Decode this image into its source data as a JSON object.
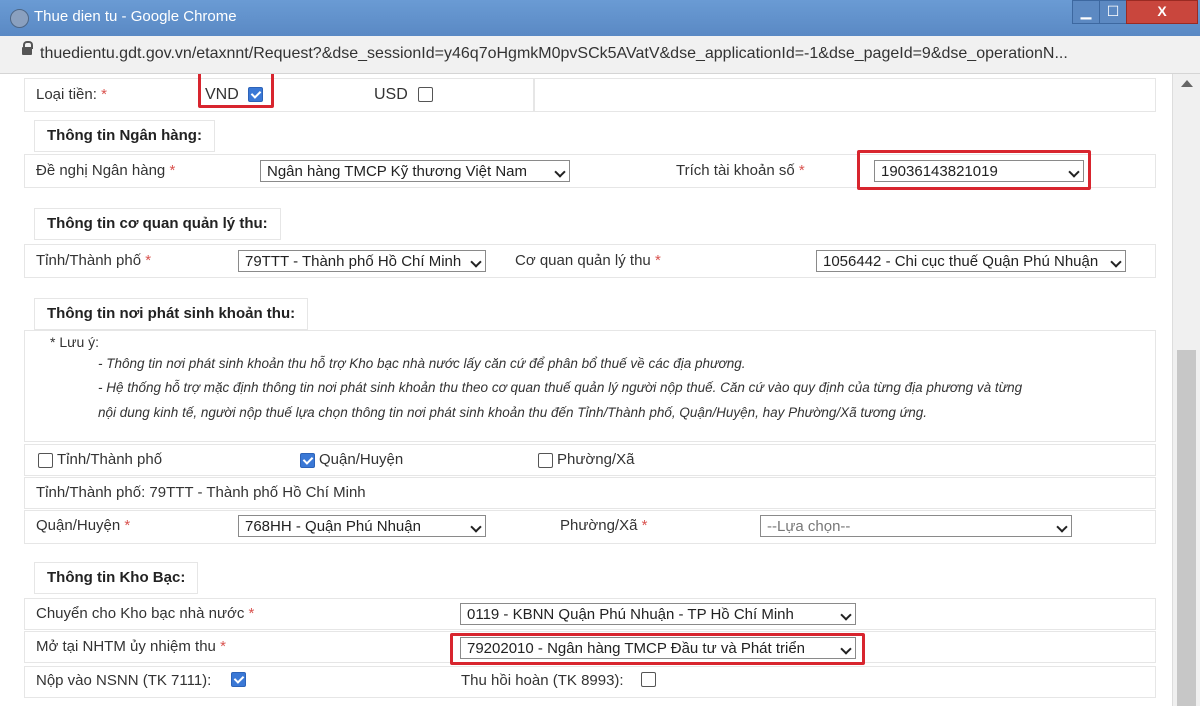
{
  "window": {
    "title": "Thue dien tu - Google Chrome",
    "url": "thuedientu.gdt.gov.vn/etaxnnt/Request?&dse_sessionId=y46q7oHgmkM0pvSCk5AVatV&dse_applicationId=-1&dse_pageId=9&dse_operationN...",
    "min_symbol": "▁",
    "max_symbol": "☐",
    "close_symbol": "X"
  },
  "currency": {
    "label": "Loại tiền:",
    "required": "*",
    "vnd_label": "VND",
    "vnd_checked": true,
    "usd_label": "USD",
    "usd_checked": false
  },
  "bank": {
    "section_title": "Thông tin Ngân hàng:",
    "bank_label": "Đề nghị Ngân hàng",
    "bank_value": "Ngân hàng TMCP Kỹ thương Việt Nam",
    "account_label": "Trích tài khoản số",
    "account_value": "19036143821019",
    "required": "*"
  },
  "agency": {
    "section_title": "Thông tin cơ quan quản lý thu:",
    "province_label": "Tỉnh/Thành phố",
    "province_value": "79TTT - Thành phố Hồ Chí Minh",
    "agency_label": "Cơ quan quản lý thu",
    "agency_value": "1056442 - Chi cục thuế Quận Phú Nhuận",
    "required": "*"
  },
  "origin": {
    "section_title": "Thông tin nơi phát sinh khoản thu:",
    "note_title": "* Lưu ý:",
    "note_line1": "- Thông tin nơi phát sinh khoản thu hỗ trợ Kho bạc nhà nước lấy căn cứ để phân bổ thuế về các địa phương.",
    "note_line2": "- Hệ thống hỗ trợ mặc định thông tin nơi phát sinh khoản thu theo cơ quan thuế quản lý người nộp thuế. Căn cứ vào quy định của từng địa phương và từng",
    "note_line3": "nội dung kinh tế, người nộp thuế lựa chọn thông tin nơi phát sinh khoản thu đến Tỉnh/Thành phố, Quận/Huyện, hay Phường/Xã tương ứng.",
    "opt_province": "Tỉnh/Thành phố",
    "opt_province_checked": false,
    "opt_district": "Quận/Huyện",
    "opt_district_checked": true,
    "opt_ward": "Phường/Xã",
    "opt_ward_checked": false,
    "province_text": "Tỉnh/Thành phố: 79TTT - Thành phố Hồ Chí Minh",
    "district_label": "Quận/Huyện",
    "district_value": "768HH - Quận Phú Nhuận",
    "ward_label": "Phường/Xã",
    "ward_value": "--Lựa chọn--",
    "required": "*"
  },
  "treasury": {
    "section_title": "Thông tin Kho Bạc:",
    "transfer_label": "Chuyển cho Kho bạc nhà nước",
    "transfer_value": "0119 - KBNN Quận Phú Nhuận - TP Hồ Chí Minh",
    "bank_label": "Mở tại NHTM ủy nhiệm thu",
    "bank_value": "79202010 - Ngân hàng TMCP Đầu tư và Phát triển",
    "nsnn_label": "Nộp vào NSNN (TK 7111):",
    "nsnn_checked": true,
    "refund_label": "Thu hồi hoàn (TK 8993):",
    "refund_checked": false,
    "required": "*"
  },
  "colors": {
    "titlebar": "#5a89c4",
    "highlight": "#d8252e",
    "checkbox_on": "#3a78d6",
    "required": "#d9534f"
  }
}
